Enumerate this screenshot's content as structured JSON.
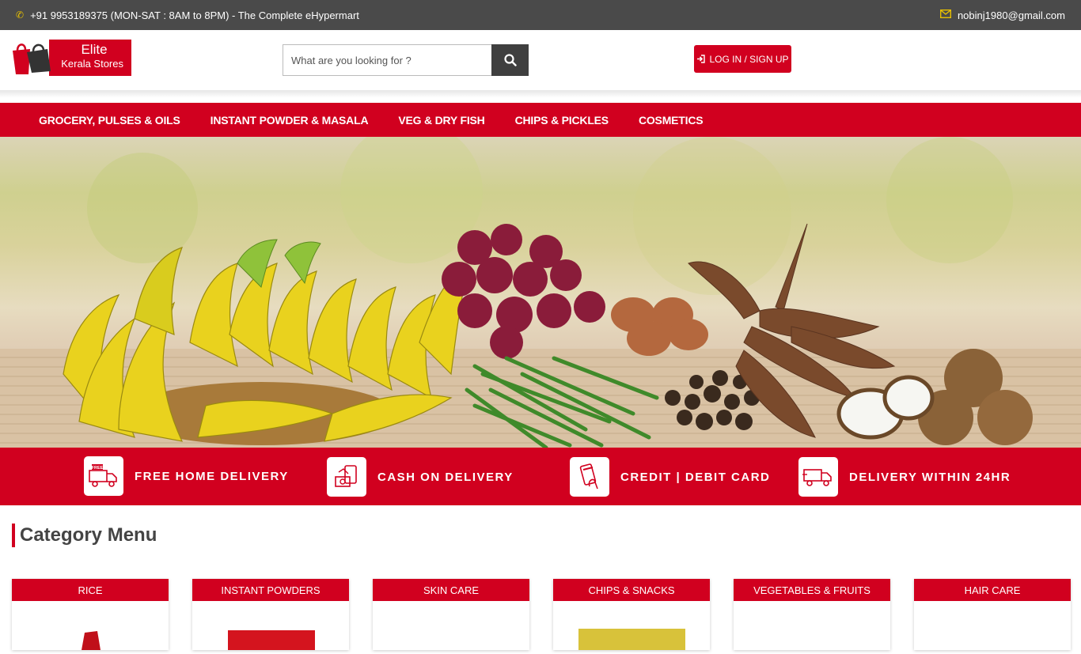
{
  "topbar": {
    "phone_text": "+91 9953189375 (MON-SAT : 8AM to 8PM) - The Complete eHypermart",
    "email": "nobinj1980@gmail.com"
  },
  "logo": {
    "line1": "Elite",
    "line2": "Kerala Stores"
  },
  "search": {
    "placeholder": "What are you looking for ?",
    "value": ""
  },
  "login_label": "LOG IN / SIGN UP",
  "nav": [
    "GROCERY, PULSES & OILS",
    "INSTANT POWDER & MASALA",
    "VEG & DRY FISH",
    "CHIPS & PICKLES",
    "COSMETICS"
  ],
  "features": [
    {
      "label": "FREE HOME DELIVERY",
      "icon": "free-delivery-truck-icon",
      "badge": "FREE"
    },
    {
      "label": "CASH ON DELIVERY",
      "icon": "cash-on-delivery-icon"
    },
    {
      "label": "CREDIT | DEBIT CARD",
      "icon": "card-payment-icon"
    },
    {
      "label": "DELIVERY WITHIN 24HR",
      "icon": "delivery-truck-icon"
    }
  ],
  "category_section_title": "Category Menu",
  "categories": [
    "RICE",
    "INSTANT POWDERS",
    "SKIN CARE",
    "CHIPS & SNACKS",
    "VEGETABLES & FRUITS",
    "HAIR CARE"
  ],
  "colors": {
    "accent": "#d1001f",
    "topbar": "#4a4a4a"
  }
}
